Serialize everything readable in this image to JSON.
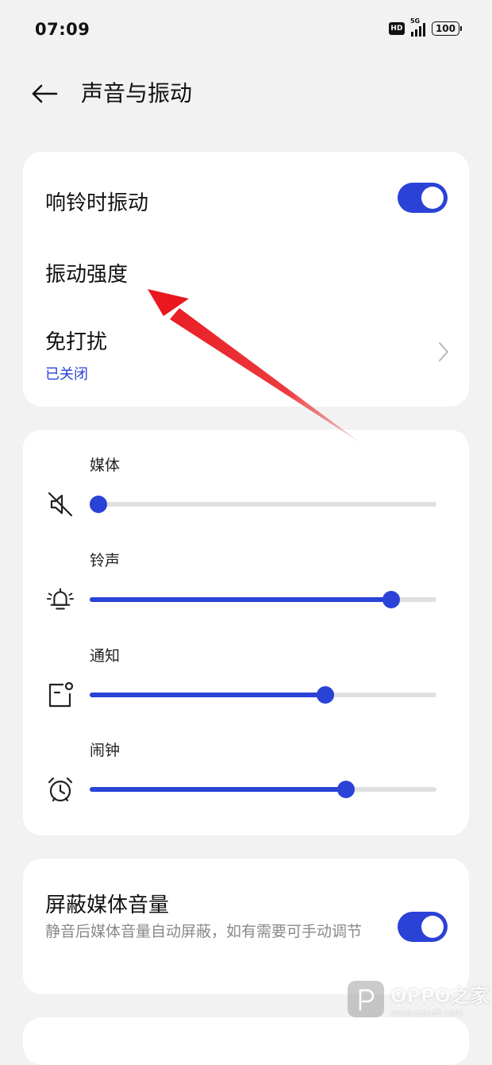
{
  "status_bar": {
    "time": "07:09",
    "hd": "HD",
    "network": "5G",
    "battery": "100"
  },
  "header": {
    "title": "声音与振动",
    "back_icon": "arrow-left-icon"
  },
  "card_vibration": {
    "vibrate_on_ring": {
      "label": "响铃时振动",
      "enabled": true
    },
    "vibration_intensity": {
      "label": "振动强度"
    },
    "do_not_disturb": {
      "label": "免打扰",
      "status": "已关闭"
    }
  },
  "volume": {
    "media": {
      "label": "媒体",
      "icon": "speaker-muted-icon",
      "level": 0.0
    },
    "ringtone": {
      "label": "铃声",
      "icon": "bell-icon",
      "level": 0.87
    },
    "notification": {
      "label": "通知",
      "icon": "notification-icon",
      "level": 0.68
    },
    "alarm": {
      "label": "闹钟",
      "icon": "alarm-clock-icon",
      "level": 0.74
    }
  },
  "mute_media": {
    "label": "屏蔽媒体音量",
    "description": "静音后媒体音量自动屏蔽，如有需要可手动调节",
    "enabled": true
  },
  "watermark": {
    "name": "OPPO之家",
    "url": "www.oppo8.com"
  },
  "colors": {
    "accent": "#2b42d6",
    "annotation_arrow": "#e8181e",
    "background": "#f2f2f2"
  }
}
